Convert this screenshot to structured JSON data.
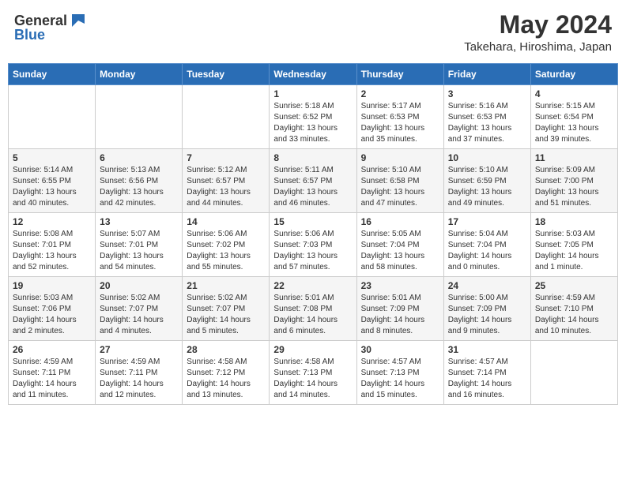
{
  "header": {
    "logo_general": "General",
    "logo_blue": "Blue",
    "month_year": "May 2024",
    "location": "Takehara, Hiroshima, Japan"
  },
  "weekdays": [
    "Sunday",
    "Monday",
    "Tuesday",
    "Wednesday",
    "Thursday",
    "Friday",
    "Saturday"
  ],
  "weeks": [
    [
      {
        "day": "",
        "info": ""
      },
      {
        "day": "",
        "info": ""
      },
      {
        "day": "",
        "info": ""
      },
      {
        "day": "1",
        "info": "Sunrise: 5:18 AM\nSunset: 6:52 PM\nDaylight: 13 hours\nand 33 minutes."
      },
      {
        "day": "2",
        "info": "Sunrise: 5:17 AM\nSunset: 6:53 PM\nDaylight: 13 hours\nand 35 minutes."
      },
      {
        "day": "3",
        "info": "Sunrise: 5:16 AM\nSunset: 6:53 PM\nDaylight: 13 hours\nand 37 minutes."
      },
      {
        "day": "4",
        "info": "Sunrise: 5:15 AM\nSunset: 6:54 PM\nDaylight: 13 hours\nand 39 minutes."
      }
    ],
    [
      {
        "day": "5",
        "info": "Sunrise: 5:14 AM\nSunset: 6:55 PM\nDaylight: 13 hours\nand 40 minutes."
      },
      {
        "day": "6",
        "info": "Sunrise: 5:13 AM\nSunset: 6:56 PM\nDaylight: 13 hours\nand 42 minutes."
      },
      {
        "day": "7",
        "info": "Sunrise: 5:12 AM\nSunset: 6:57 PM\nDaylight: 13 hours\nand 44 minutes."
      },
      {
        "day": "8",
        "info": "Sunrise: 5:11 AM\nSunset: 6:57 PM\nDaylight: 13 hours\nand 46 minutes."
      },
      {
        "day": "9",
        "info": "Sunrise: 5:10 AM\nSunset: 6:58 PM\nDaylight: 13 hours\nand 47 minutes."
      },
      {
        "day": "10",
        "info": "Sunrise: 5:10 AM\nSunset: 6:59 PM\nDaylight: 13 hours\nand 49 minutes."
      },
      {
        "day": "11",
        "info": "Sunrise: 5:09 AM\nSunset: 7:00 PM\nDaylight: 13 hours\nand 51 minutes."
      }
    ],
    [
      {
        "day": "12",
        "info": "Sunrise: 5:08 AM\nSunset: 7:01 PM\nDaylight: 13 hours\nand 52 minutes."
      },
      {
        "day": "13",
        "info": "Sunrise: 5:07 AM\nSunset: 7:01 PM\nDaylight: 13 hours\nand 54 minutes."
      },
      {
        "day": "14",
        "info": "Sunrise: 5:06 AM\nSunset: 7:02 PM\nDaylight: 13 hours\nand 55 minutes."
      },
      {
        "day": "15",
        "info": "Sunrise: 5:06 AM\nSunset: 7:03 PM\nDaylight: 13 hours\nand 57 minutes."
      },
      {
        "day": "16",
        "info": "Sunrise: 5:05 AM\nSunset: 7:04 PM\nDaylight: 13 hours\nand 58 minutes."
      },
      {
        "day": "17",
        "info": "Sunrise: 5:04 AM\nSunset: 7:04 PM\nDaylight: 14 hours\nand 0 minutes."
      },
      {
        "day": "18",
        "info": "Sunrise: 5:03 AM\nSunset: 7:05 PM\nDaylight: 14 hours\nand 1 minute."
      }
    ],
    [
      {
        "day": "19",
        "info": "Sunrise: 5:03 AM\nSunset: 7:06 PM\nDaylight: 14 hours\nand 2 minutes."
      },
      {
        "day": "20",
        "info": "Sunrise: 5:02 AM\nSunset: 7:07 PM\nDaylight: 14 hours\nand 4 minutes."
      },
      {
        "day": "21",
        "info": "Sunrise: 5:02 AM\nSunset: 7:07 PM\nDaylight: 14 hours\nand 5 minutes."
      },
      {
        "day": "22",
        "info": "Sunrise: 5:01 AM\nSunset: 7:08 PM\nDaylight: 14 hours\nand 6 minutes."
      },
      {
        "day": "23",
        "info": "Sunrise: 5:01 AM\nSunset: 7:09 PM\nDaylight: 14 hours\nand 8 minutes."
      },
      {
        "day": "24",
        "info": "Sunrise: 5:00 AM\nSunset: 7:09 PM\nDaylight: 14 hours\nand 9 minutes."
      },
      {
        "day": "25",
        "info": "Sunrise: 4:59 AM\nSunset: 7:10 PM\nDaylight: 14 hours\nand 10 minutes."
      }
    ],
    [
      {
        "day": "26",
        "info": "Sunrise: 4:59 AM\nSunset: 7:11 PM\nDaylight: 14 hours\nand 11 minutes."
      },
      {
        "day": "27",
        "info": "Sunrise: 4:59 AM\nSunset: 7:11 PM\nDaylight: 14 hours\nand 12 minutes."
      },
      {
        "day": "28",
        "info": "Sunrise: 4:58 AM\nSunset: 7:12 PM\nDaylight: 14 hours\nand 13 minutes."
      },
      {
        "day": "29",
        "info": "Sunrise: 4:58 AM\nSunset: 7:13 PM\nDaylight: 14 hours\nand 14 minutes."
      },
      {
        "day": "30",
        "info": "Sunrise: 4:57 AM\nSunset: 7:13 PM\nDaylight: 14 hours\nand 15 minutes."
      },
      {
        "day": "31",
        "info": "Sunrise: 4:57 AM\nSunset: 7:14 PM\nDaylight: 14 hours\nand 16 minutes."
      },
      {
        "day": "",
        "info": ""
      }
    ]
  ]
}
